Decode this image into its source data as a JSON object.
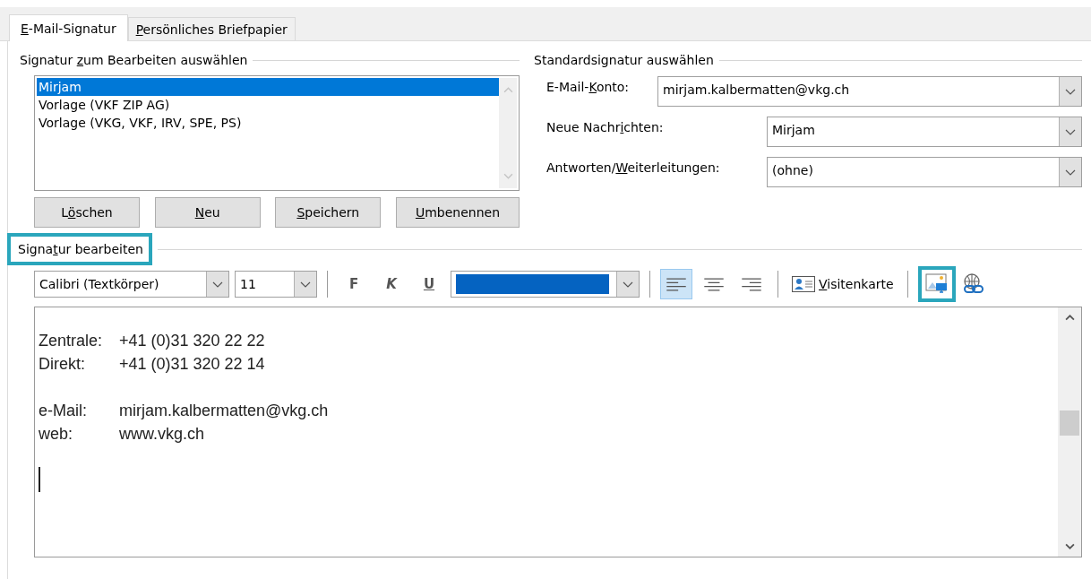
{
  "tabs": [
    {
      "label": {
        "key": "E",
        "after": "-Mail-Signatur"
      },
      "selected": true
    },
    {
      "label": {
        "key": "P",
        "after": "ersönliches Briefpapier"
      },
      "selected": false
    }
  ],
  "edit_group": {
    "heading": {
      "before": "Signatur ",
      "key": "z",
      "after": "um Bearbeiten auswählen"
    },
    "signatures": [
      {
        "name": "Mirjam",
        "selected": true
      },
      {
        "name": "Vorlage (VKF ZIP AG)",
        "selected": false
      },
      {
        "name": "Vorlage (VKG, VKF, IRV, SPE, PS)",
        "selected": false
      }
    ],
    "buttons": [
      {
        "before": "L",
        "key": "ö",
        "after": "schen"
      },
      {
        "key": "N",
        "after": "eu"
      },
      {
        "key": "S",
        "after": "peichern"
      },
      {
        "key": "U",
        "after": "mbenennen"
      }
    ]
  },
  "default_group": {
    "heading": {
      "after": "Standardsignatur auswählen"
    },
    "fields": [
      {
        "label": {
          "before": "E-Mail-",
          "key": "K",
          "after": "onto:"
        },
        "value": "mirjam.kalbermatten@vkg.ch",
        "kind": "wide"
      },
      {
        "label": {
          "before": "Neue Nachr",
          "key": "i",
          "after": "chten:"
        },
        "value": "Mirjam",
        "kind": "narrow"
      },
      {
        "label": {
          "before": "Antworten/",
          "key": "W",
          "after": "eiterleitungen:"
        },
        "value": "(ohne)",
        "kind": "narrow"
      }
    ]
  },
  "editor_group": {
    "heading": {
      "before": "Signa",
      "key": "t",
      "after": "ur bearbeiten"
    },
    "highlighted": true,
    "toolbar": {
      "font": "Calibri (Textkörper)",
      "size": "11",
      "bold": "F",
      "italic": "K",
      "underline": "U",
      "color": "#0563c1",
      "align": [
        {
          "kind": "left",
          "selected": true
        },
        {
          "kind": "center",
          "selected": false
        },
        {
          "kind": "right",
          "selected": false
        }
      ],
      "business_card": {
        "key": "V",
        "after": "isitenkarte"
      },
      "picture_highlighted": true
    },
    "blocks": [
      [
        {
          "label": "Zentrale:",
          "value": "+41 (0)31 320 22 22"
        },
        {
          "label": "Direkt:",
          "value": "+41 (0)31 320 22 14"
        }
      ],
      [
        {
          "label": "e-Mail:",
          "value": "mirjam.kalbermatten@vkg.ch"
        },
        {
          "label": "web:",
          "value": "www.vkg.ch"
        }
      ]
    ]
  }
}
